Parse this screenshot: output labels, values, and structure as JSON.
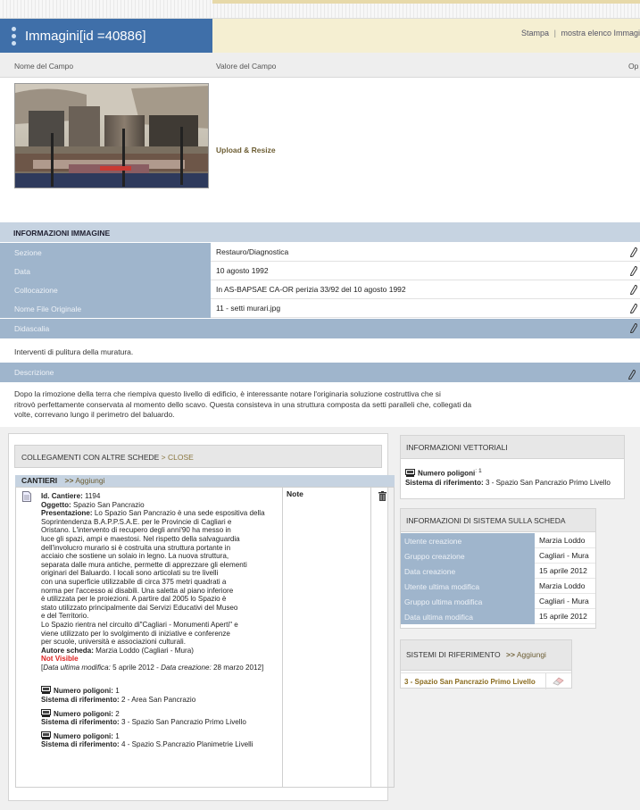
{
  "header": {
    "title": "Immagini[id =40886]",
    "actions": [
      "Stampa",
      "mostra elenco Immagi"
    ],
    "separator": "|"
  },
  "columns": {
    "field_name": "Nome del Campo",
    "field_value": "Valore del Campo",
    "options": "Op"
  },
  "upload_label": "Upload & Resize",
  "info_section_title": "INFORMAZIONI IMMAGINE",
  "info_rows": [
    {
      "label": "Sezione",
      "value": "Restauro/Diagnostica"
    },
    {
      "label": "Data",
      "value": "10 agosto 1992"
    },
    {
      "label": "Collocazione",
      "value": "In AS-BAPSAE CA-OR perizia 33/92 del 10 agosto 1992"
    },
    {
      "label": "Nome File Originale",
      "value": "11 - setti murari.jpg"
    }
  ],
  "didascalia": {
    "label": "Didascalia",
    "text": "Interventi di pulitura della muratura."
  },
  "descrizione": {
    "label": "Descrizione",
    "lines": [
      "Dopo la rimozione della terra che riempiva questo livello di edificio, è interessante notare l'originaria soluzione costruttiva che si",
      "ritrovò perfettamente conservata al momento dello scavo. Questa consisteva in una struttura composta da setti paralleli che, collegati da",
      "volte, correvano lungo il perimetro del baluardo."
    ]
  },
  "collegamenti": {
    "title": "COLLEGAMENTI CON ALTRE SCHEDE",
    "arrow": ">",
    "close_label": "CLOSE"
  },
  "cantieri": {
    "title": "CANTIERI",
    "arrow": ">>",
    "add_label": "Aggiungi",
    "note_label": "Note",
    "entry": {
      "id_label": "Id. Cantiere:",
      "id_value": "1194",
      "oggetto_label": "Oggetto:",
      "oggetto_value": "Spazio San Pancrazio",
      "presentazione_label": "Presentazione:",
      "presentazione_first": "Lo Spazio San Pancrazio è una sede espositiva della",
      "presentazione_lines": [
        "Soprintendenza B.A.P.P.S.A.E. per le Provincie di Cagliari e",
        "Oristano. L'intervento di recupero degli anni'90 ha messo in",
        "luce gli spazi, ampi e maestosi. Nel rispetto della salvaguardia",
        "dell'involucro murario si è costruita una struttura portante in",
        "acciaio che sostiene un solaio in legno. La nuova struttura,",
        "separata dalle mura antiche, permette di apprezzare gli elementi",
        "originari del Baluardo. I locali sono articolati su tre livelli",
        "con una superficie utilizzabile di circa 375 metri quadrati a",
        "norma per l'accesso ai disabili. Una saletta al piano inferiore",
        "è utilizzata per le proiezioni. A partire dal 2005 lo Spazio è",
        "stato utilizzato principalmente dai Servizi Educativi del Museo",
        "e del Territorio.",
        "Lo Spazio rientra nel circuito di\"Cagliari - Monumenti Aperti\" e",
        "viene utilizzato per lo svolgimento di iniziative e conferenze",
        "per scuole, università e associazioni culturali."
      ],
      "autore_label": "Autore scheda:",
      "autore_value": "Marzia Loddo (Cagliari - Mura)",
      "visibility": "Not Visible",
      "ultima_mod_label": "Data ultima modifica:",
      "ultima_mod_value": "5 aprile 2012",
      "creazione_label": "Data creazione:",
      "creazione_value": "28 marzo 2012",
      "open_bracket": "[",
      "close_bracket": "]",
      "dash": "-"
    },
    "polygons": [
      {
        "count_label": "Numero poligoni:",
        "count": "1",
        "ref_label": "Sistema di riferimento:",
        "ref": "2 - Area San Pancrazio"
      },
      {
        "count_label": "Numero poligoni:",
        "count": "2",
        "ref_label": "Sistema di riferimento:",
        "ref": "3 - Spazio San Pancrazio Primo Livello"
      },
      {
        "count_label": "Numero poligoni:",
        "count": "1",
        "ref_label": "Sistema di riferimento:",
        "ref": "4 - Spazio S.Pancrazio Planimetrie Livelli"
      }
    ]
  },
  "vettoriali": {
    "title": "INFORMAZIONI VETTORIALI",
    "count_label": "Numero poligoni",
    "count": ": 1",
    "ref_label": "Sistema di riferimento:",
    "ref": "3 - Spazio San Pancrazio Primo Livello"
  },
  "sistema": {
    "title": "INFORMAZIONI DI SISTEMA SULLA SCHEDA",
    "rows": [
      {
        "label": "Utente creazione",
        "value": "Marzia Loddo"
      },
      {
        "label": "Gruppo creazione",
        "value": "Cagliari - Mura"
      },
      {
        "label": "Data creazione",
        "value": "15 aprile 2012"
      },
      {
        "label": "Utente ultima modifica",
        "value": "Marzia Loddo"
      },
      {
        "label": "Gruppo ultima modifica",
        "value": "Cagliari - Mura"
      },
      {
        "label": "Data ultima modifica",
        "value": "15 aprile 2012"
      }
    ]
  },
  "riferimento": {
    "title": "SISTEMI DI RIFERIMENTO",
    "arrow": ">>",
    "add_label": "Aggiungi",
    "item": "3 - Spazio San Pancrazio Primo Livello"
  },
  "icons": [
    "menu-dots-icon",
    "pencil-icon",
    "document-icon",
    "trash-icon",
    "polygon-icon",
    "eraser-icon"
  ],
  "colors": {
    "title_bg": "#3f6fa9",
    "label_bg": "#9fb5cc",
    "section_bg": "#c6d3e1",
    "action_bar_bg": "#f5efd2",
    "link": "#6d5e34",
    "not_visible": "#dd2222"
  }
}
